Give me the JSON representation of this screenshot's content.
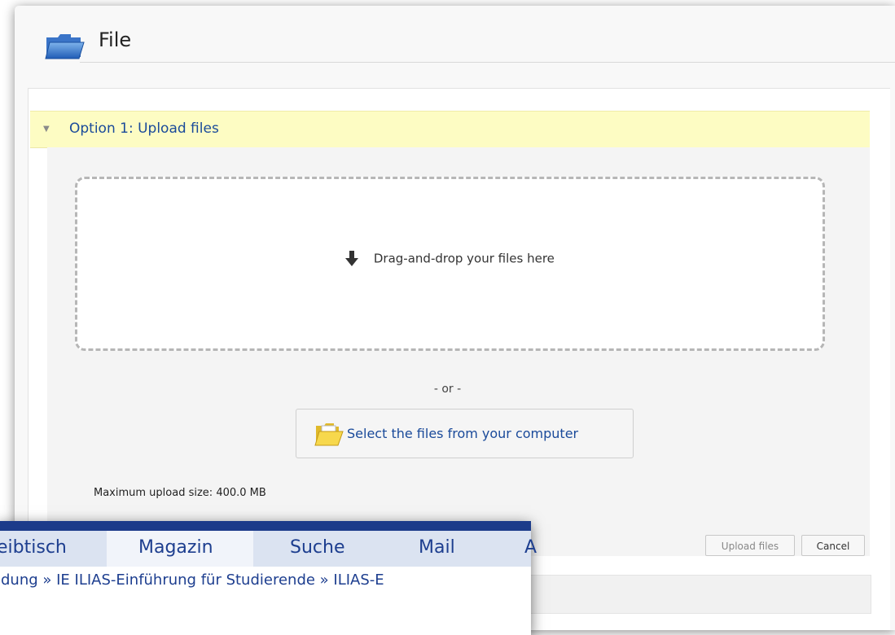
{
  "header": {
    "title": "File"
  },
  "option": {
    "arrow": "▼",
    "title": "Option 1: Upload files"
  },
  "dropzone": {
    "text": "Drag-and-drop your files here"
  },
  "or_text": "- or -",
  "select_button": {
    "label": "Select the files from your computer"
  },
  "max_upload": "Maximum upload size: 400.0 MB",
  "buttons": {
    "upload": "Upload files",
    "cancel": "Cancel"
  },
  "nav": {
    "items": [
      "eibtisch",
      "Magazin",
      "Suche",
      "Mail",
      "A"
    ],
    "active": "Magazin"
  },
  "breadcrumb": "ldung » IE ILIAS-Einführung für Studierende » ILIAS-E",
  "colors": {
    "link": "#1a4a9a",
    "option_bg": "#fdfcc3",
    "nav_bg": "#dbe3f1",
    "nav_topbar": "#1c3b8a"
  }
}
